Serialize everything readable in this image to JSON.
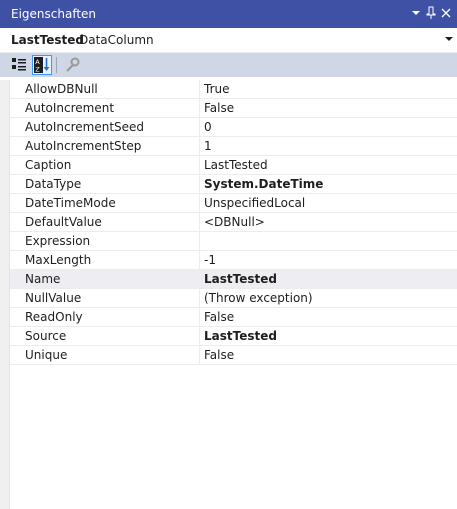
{
  "window": {
    "title": "Eigenschaften"
  },
  "object": {
    "name": "LastTested",
    "type": "DataColumn"
  },
  "properties": [
    {
      "name": "AllowDBNull",
      "value": "True"
    },
    {
      "name": "AutoIncrement",
      "value": "False"
    },
    {
      "name": "AutoIncrementSeed",
      "value": "0"
    },
    {
      "name": "AutoIncrementStep",
      "value": "1"
    },
    {
      "name": "Caption",
      "value": "LastTested"
    },
    {
      "name": "DataType",
      "value": "System.DateTime"
    },
    {
      "name": "DateTimeMode",
      "value": "UnspecifiedLocal"
    },
    {
      "name": "DefaultValue",
      "value": "<DBNull>"
    },
    {
      "name": "Expression",
      "value": ""
    },
    {
      "name": "MaxLength",
      "value": "-1"
    },
    {
      "name": "Name",
      "value": "LastTested"
    },
    {
      "name": "NullValue",
      "value": "(Throw exception)"
    },
    {
      "name": "ReadOnly",
      "value": "False"
    },
    {
      "name": "Source",
      "value": "LastTested"
    },
    {
      "name": "Unique",
      "value": "False"
    }
  ],
  "icons": {
    "title": [
      "dropdown-icon",
      "pin-icon",
      "close-icon"
    ],
    "toolbar": [
      "categorized-icon",
      "alphabetical-icon",
      "property-pages-icon"
    ]
  },
  "colors": {
    "titlebar": "#3f51a5",
    "toolbar": "#cfd6e5",
    "selected_row": "#eeeef2"
  }
}
